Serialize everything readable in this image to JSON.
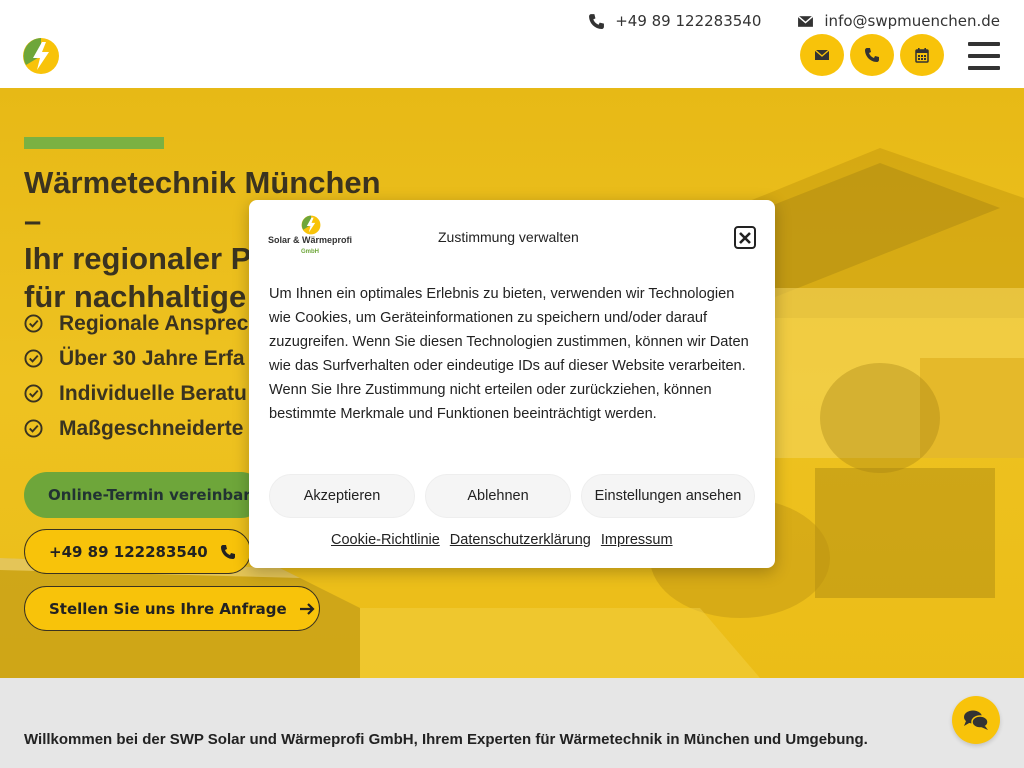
{
  "header": {
    "phone": "+49 89 122283540",
    "email": "info@swpmuenchen.de",
    "circle_buttons": [
      "envelope-icon",
      "phone-icon",
      "calendar-icon"
    ],
    "menu_icon": "hamburger-icon"
  },
  "hero": {
    "title_lines": [
      "Wärmetechnik München –",
      "Ihr regionaler Pa",
      "für nachhaltige E"
    ],
    "checklist": [
      "Regionale Ansprec",
      "Über 30 Jahre Erfa",
      "Individuelle Beratu",
      "Maßgeschneiderte"
    ],
    "btn_online": "Online-Termin vereinbaren",
    "btn_phone": "+49 89 122283540",
    "btn_request": "Stellen Sie uns Ihre Anfrage"
  },
  "bottom": {
    "welcome": "Willkommen bei der SWP Solar und Wärmeprofi GmbH, Ihrem Experten für Wärmetechnik in München und Umgebung."
  },
  "modal": {
    "logo_name": "Solar & Wärmeprofi",
    "logo_sub": "GmbH",
    "title": "Zustimmung verwalten",
    "body": "Um Ihnen ein optimales Erlebnis zu bieten, verwenden wir Technologien wie Cookies, um Geräteinformationen zu speichern und/oder darauf zuzugreifen. Wenn Sie diesen Technologien zustimmen, können wir Daten wie das Surfverhalten oder eindeutige IDs auf dieser Website verarbeiten. Wenn Sie Ihre Zustimmung nicht erteilen oder zurückziehen, können bestimmte Merkmale und Funktionen beeinträchtigt werden.",
    "btn_accept": "Akzeptieren",
    "btn_reject": "Ablehnen",
    "btn_settings": "Einstellungen ansehen",
    "links": [
      "Cookie-Richtlinie",
      "Datenschutzerklärung",
      "Impressum"
    ]
  },
  "colors": {
    "accent_yellow": "#f8c30a",
    "accent_green": "#6ea63a",
    "text_dark": "#3a3320"
  }
}
